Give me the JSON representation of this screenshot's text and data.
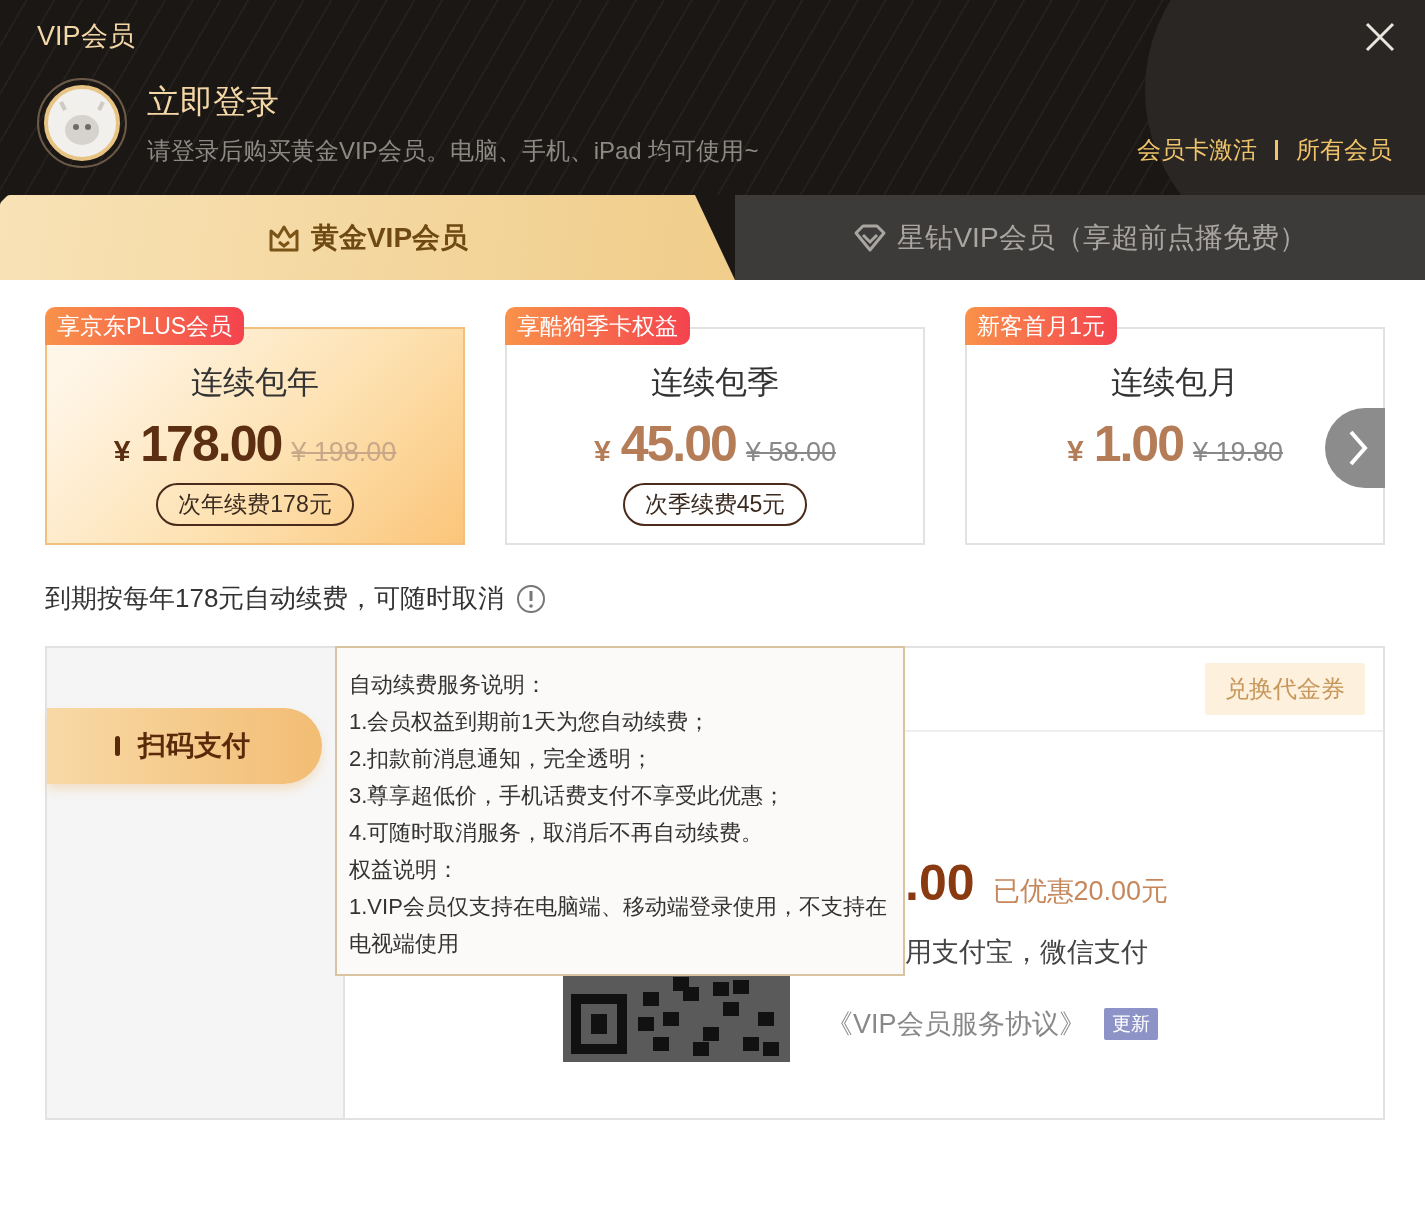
{
  "window": {
    "title": "VIP会员"
  },
  "login": {
    "title": "立即登录",
    "subtitle": "请登录后购买黄金VIP会员。电脑、手机、iPad 均可使用~",
    "links": [
      "会员卡激活",
      "所有会员"
    ]
  },
  "tabs": [
    {
      "label": "黄金VIP会员",
      "selected": true
    },
    {
      "label": "星钻VIP会员（享超前点播免费）",
      "selected": false
    }
  ],
  "plans": [
    {
      "badge": "享京东PLUS会员",
      "name": "连续包年",
      "currency": "¥",
      "price": "178.00",
      "original_price": "¥ 198.00",
      "renewal": "次年续费178元",
      "selected": true
    },
    {
      "badge": "享酷狗季卡权益",
      "name": "连续包季",
      "currency": "¥",
      "price": "45.00",
      "original_price": "¥ 58.00",
      "renewal": "次季续费45元",
      "selected": false
    },
    {
      "badge": "新客首月1元",
      "name": "连续包月",
      "currency": "¥",
      "price": "1.00",
      "original_price": "¥ 19.80",
      "selected": false
    }
  ],
  "renewal_note": "到期按每年178元自动续费，可随时取消",
  "tooltip": {
    "lines": [
      "自动续费服务说明：",
      "1.会员权益到期前1天为您自动续费；",
      "2.扣款前消息通知，完全透明；",
      "3.尊享超低价，手机话费支付不享受此优惠；",
      "4.可随时取消服务，取消后不再自动续费。",
      "权益说明：",
      "1.VIP会员仅支持在电脑端、移动端登录使用，不支持在电视端使用"
    ]
  },
  "payment": {
    "methods": [
      {
        "label": "扫码支付",
        "selected": true
      }
    ],
    "voucher_button": "兑换代金券",
    "price": ".00",
    "discount": "已优惠20.00元",
    "pay_hint": "用支付宝，微信支付",
    "agreement": "《VIP会员服务协议》",
    "agreement_badge": "更新"
  }
}
